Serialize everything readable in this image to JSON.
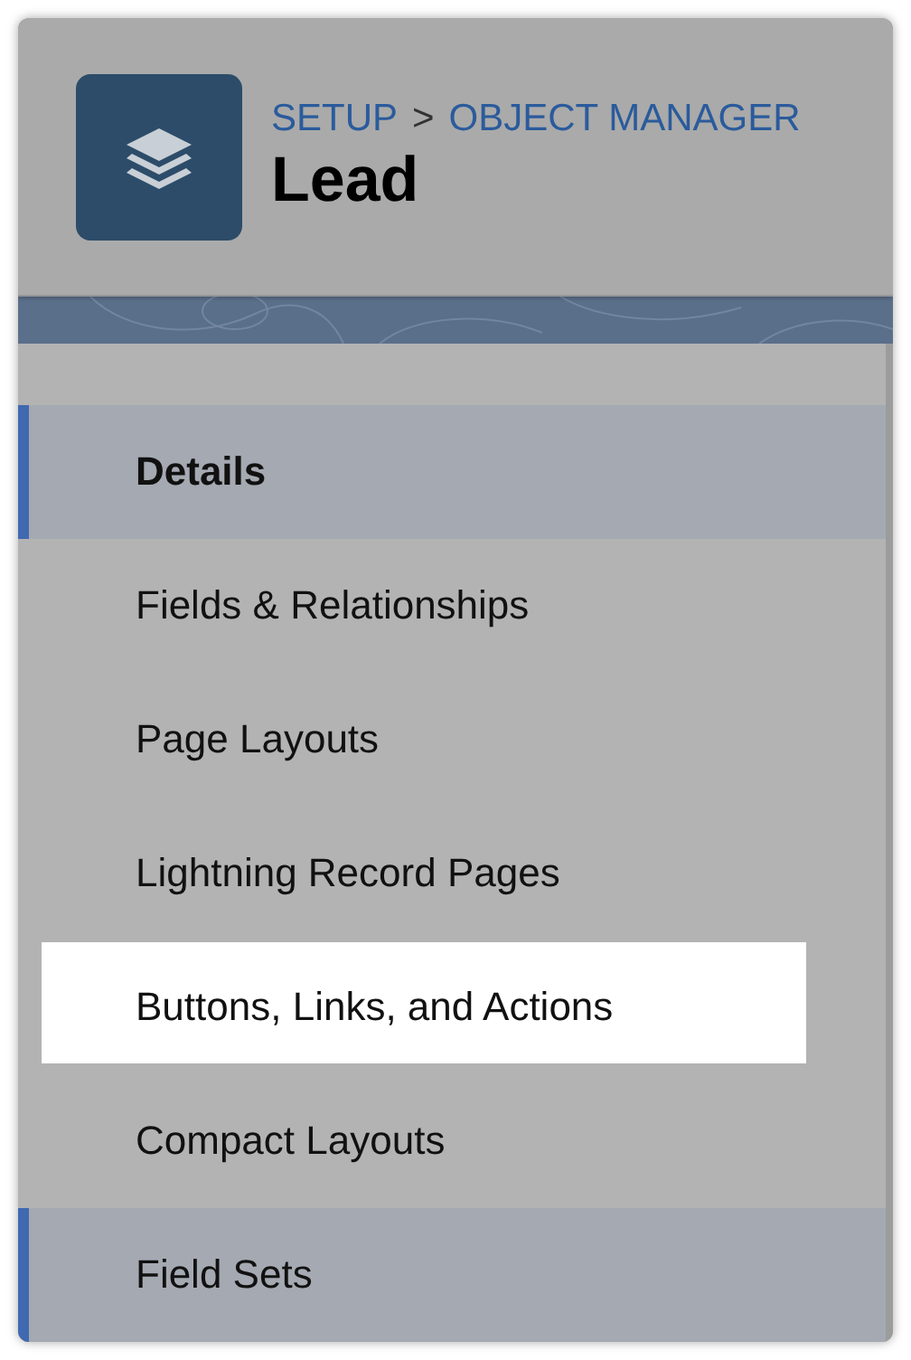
{
  "header": {
    "breadcrumb": [
      {
        "label": "SETUP"
      },
      {
        "label": "OBJECT MANAGER"
      }
    ],
    "separator": ">",
    "title": "Lead"
  },
  "sidebar": {
    "items": [
      {
        "label": "Details",
        "selected": true,
        "highlighted": true,
        "spotlit": false
      },
      {
        "label": "Fields & Relationships",
        "selected": false,
        "highlighted": false,
        "spotlit": false
      },
      {
        "label": "Page Layouts",
        "selected": false,
        "highlighted": false,
        "spotlit": false
      },
      {
        "label": "Lightning Record Pages",
        "selected": false,
        "highlighted": false,
        "spotlit": false
      },
      {
        "label": "Buttons, Links, and Actions",
        "selected": false,
        "highlighted": false,
        "spotlit": true
      },
      {
        "label": "Compact Layouts",
        "selected": false,
        "highlighted": false,
        "spotlit": false
      },
      {
        "label": "Field Sets",
        "selected": false,
        "highlighted": true,
        "spotlit": false
      }
    ]
  }
}
